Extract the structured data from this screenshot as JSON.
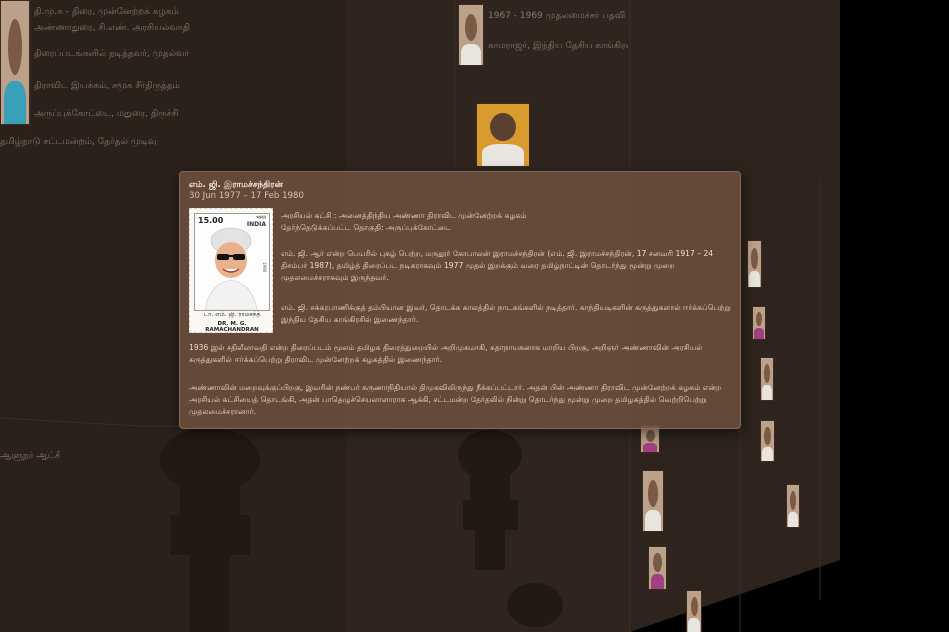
{
  "card": {
    "title": "எம். ஜி. இராமச்சந்திரன்",
    "dates": "30 Jun 1977 – 17 Feb 1980",
    "party_line": "அரசியல் கட்சி : அனைத்திந்திய அண்ணா திராவிட முன்னேற்றக் கழகம்",
    "constituency_line": "தேர்ந்தெடுக்கப்பட்ட தொகுதி: அருப்புக்கோட்டை",
    "paragraphs": [
      "எம். ஜி. ஆர் என்ற பெயரில் புகழ் பெற்ற, மருதூர் கோபாலன் இராமச்சந்திரன் (எம். ஜி. இராமச்சந்திரன், 17 சனவரி 1917 – 24 திசம்பர் 1987), தமிழ்த் திரைப்பட நடிகராகவும் 1977 முதல் இறக்கும் வரை தமிழ்நாட்டின் தொடர்ந்து மூன்று முறை முதலமைச்சராகவும் இருந்தவர்.",
      "எம். ஜி. சக்கரபாணிக்குத் தம்பியான இவர், தொடக்க காலத்தில் நாடகங்களில் நடித்தார். காந்தியடிகளின் கருத்துகளால் ஈர்க்கப்பெற்று இந்திய தேசிய காங்கிரசில் இணைந்தார்.",
      "1936 இல் சதிலீலாவதி என்ற திரைப்படம் மூலம் தமிழக திரைத்துறையில் அறிமுகமாகி, கதாநாயகனாக மாறிய பிறகு, அறிஞர் அண்ணாவின் அரசியல் கருத்துகளில் ஈர்க்கப்பெற்று திராவிட முன்னேற்றக் கழகத்தில் இணைந்தார்.",
      "அண்ணாவின் மறைவுக்குப்பிறகு, இவரின் நண்பர் கருணாநிதியால் திமுகவிலிருந்து நீக்கப்பட்டார். அதன் பின் அண்ணா திராவிட முன்னேற்றக் கழகம் என்ற அரசியல் கட்சியைத் தொடங்கி, அதன் பாதெழுச்செயலாளாராக ஆக்கி, சட்டமன்ற தேர்தலில் நின்று தொடர்ந்து மூன்று முறை தமிழகத்தில் வெற்றிபெற்று முதலமைச்சரானார்."
    ],
    "stamp": {
      "value": "15.00",
      "country_native": "भारत",
      "country": "INDIA",
      "year": "1990",
      "tamil_name": "டா. எம். ஜி. ராமசந்த்",
      "english_name": "DR. M. G. RAMACHANDRAN"
    }
  },
  "background": {
    "text_lines": [
      "தி.மு.க - திரை, முன்னேற்றக் கழகம்",
      "அண்ணாதுரை, சி.எண். அரசியல்வாதி",
      "திரைப்படங்களில் நடித்தவர், முதல்வர்",
      "திராவிட இயக்கம், சமூக சீர்திருத்தம்",
      "அருப்புக்கோட்டை, மதுரை, திருச்சி",
      "தமிழ்நாடு சட்டமன்றம், தேர்தல் முடிவு",
      "1967 - 1969 முதலமைச்சர் பதவி",
      "காமராஜர், இந்திய தேசிய காங்கிரஸ்",
      "ஆளுநர் ஆட்சி, சென்னை மாநிலம்"
    ]
  }
}
